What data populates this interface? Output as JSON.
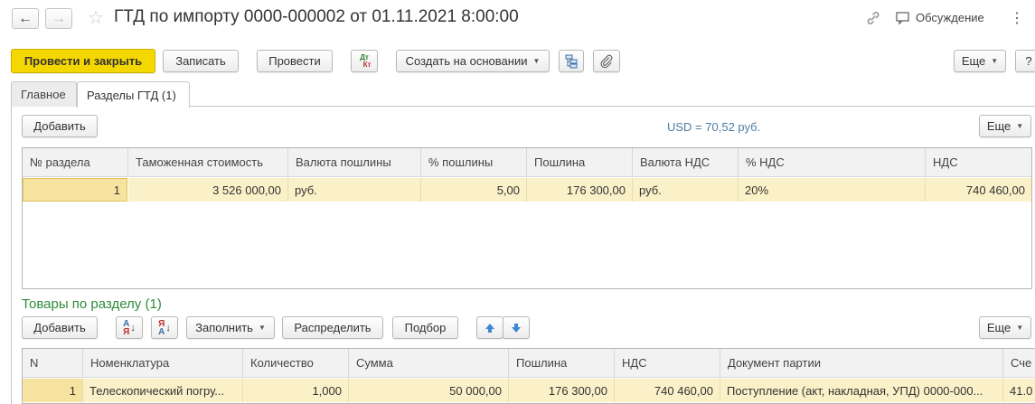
{
  "window": {
    "title": "ГТД по импорту 0000-000002 от 01.11.2021 8:00:00",
    "discussion_label": "Обсуждение",
    "back_icon": "←",
    "forward_icon": "→",
    "star_icon": "☆",
    "link_icon": "🔗",
    "more_icon": "⋮"
  },
  "toolbar": {
    "post_close": "Провести и закрыть",
    "save": "Записать",
    "post": "Провести",
    "dtkt_top": "Дт",
    "dtkt_bottom": "Кт",
    "create_based": "Создать на основании",
    "more": "Еще",
    "help": "?"
  },
  "tabs": [
    {
      "label": "Главное",
      "active": false
    },
    {
      "label": "Разделы ГТД (1)",
      "active": true
    }
  ],
  "sections": {
    "add_button": "Добавить",
    "currency_rate": "USD = 70,52 руб.",
    "more": "Еще",
    "columns": [
      "№ раздела",
      "Таможенная стоимость",
      "Валюта пошлины",
      "% пошлины",
      "Пошлина",
      "Валюта НДС",
      "% НДС",
      "НДС"
    ],
    "rows": [
      [
        "1",
        "3 526 000,00",
        "руб.",
        "5,00",
        "176 300,00",
        "руб.",
        "20%",
        "740 460,00"
      ]
    ]
  },
  "goods": {
    "title": "Товары по разделу (1)",
    "add_button": "Добавить",
    "sort_asc_top": "А",
    "sort_asc_bottom": "Я",
    "sort_desc_top": "Я",
    "sort_desc_bottom": "А",
    "fill_button": "Заполнить",
    "distribute_button": "Распределить",
    "pick_button": "Подбор",
    "more": "Еще",
    "columns": [
      "N",
      "Номенклатура",
      "Количество",
      "Сумма",
      "Пошлина",
      "НДС",
      "Документ партии",
      "Сче"
    ],
    "rows": [
      [
        "1",
        "Телескопический погру...",
        "1,000",
        "50 000,00",
        "176 300,00",
        "740 460,00",
        "Поступление (акт, накладная, УПД) 0000-000...",
        "41.0"
      ]
    ]
  },
  "colors": {
    "primary": "#f5d700",
    "section_title": "#2e8b3a",
    "rate_text": "#4c7da6",
    "row_highlight": "#fbf1c8"
  }
}
